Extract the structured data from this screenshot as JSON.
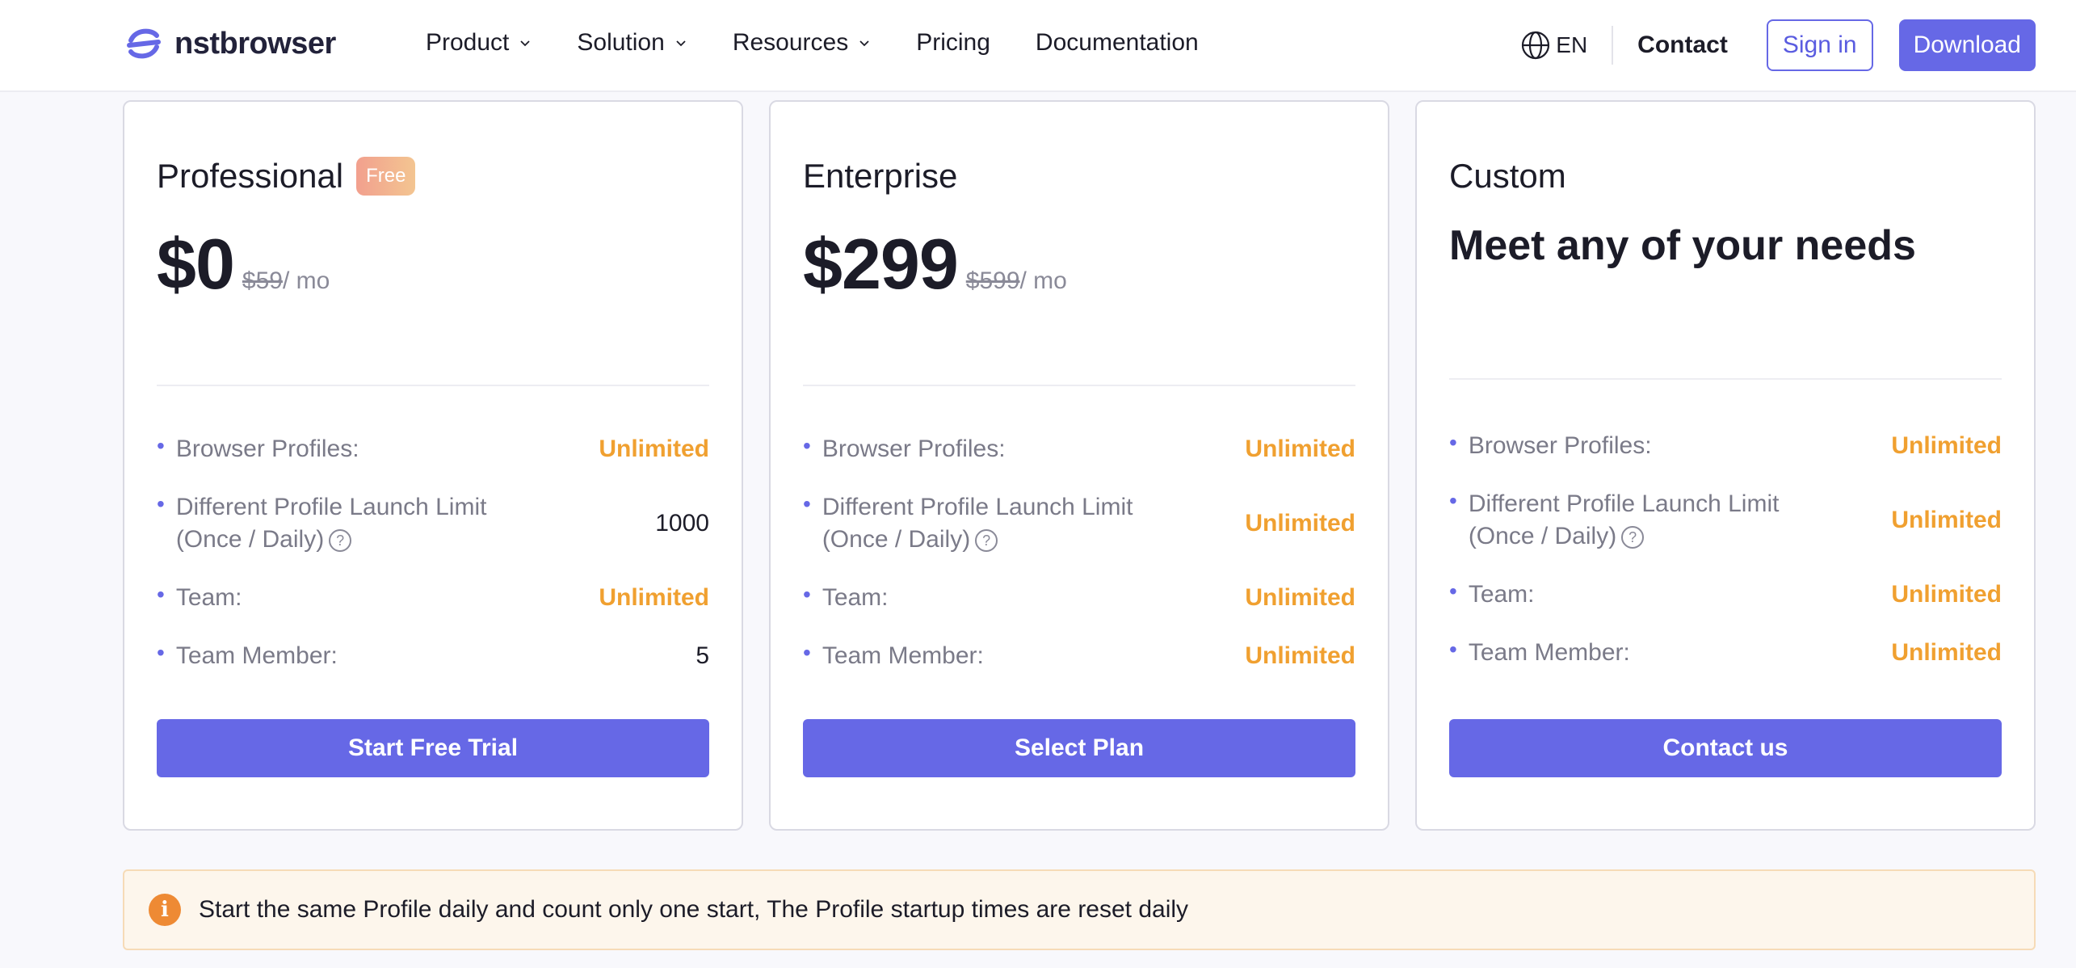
{
  "brand": {
    "name": "nstbrowser"
  },
  "nav": {
    "items": [
      {
        "label": "Product",
        "dropdown": true
      },
      {
        "label": "Solution",
        "dropdown": true
      },
      {
        "label": "Resources",
        "dropdown": true
      },
      {
        "label": "Pricing",
        "dropdown": false
      },
      {
        "label": "Documentation",
        "dropdown": false
      }
    ],
    "language": "EN",
    "contact": "Contact",
    "signin": "Sign in",
    "download": "Download"
  },
  "plans": [
    {
      "name": "Professional",
      "badge": "Free",
      "price": "$0",
      "old_price": "$59",
      "per": "/ mo",
      "features": [
        {
          "label": "Browser Profiles:",
          "value": "Unlimited",
          "highlight": true
        },
        {
          "label": "Different Profile Launch Limit (Once / Daily)",
          "value": "1000",
          "highlight": false,
          "help": true
        },
        {
          "label": "Team:",
          "value": "Unlimited",
          "highlight": true
        },
        {
          "label": "Team Member:",
          "value": "5",
          "highlight": false
        }
      ],
      "cta": "Start Free Trial"
    },
    {
      "name": "Enterprise",
      "price": "$299",
      "old_price": "$599",
      "per": "/ mo",
      "features": [
        {
          "label": "Browser Profiles:",
          "value": "Unlimited",
          "highlight": true
        },
        {
          "label": "Different Profile Launch Limit (Once / Daily)",
          "value": "Unlimited",
          "highlight": true,
          "help": true
        },
        {
          "label": "Team:",
          "value": "Unlimited",
          "highlight": true
        },
        {
          "label": "Team Member:",
          "value": "Unlimited",
          "highlight": true
        }
      ],
      "cta": "Select Plan"
    },
    {
      "name": "Custom",
      "headline": "Meet any of your needs",
      "features": [
        {
          "label": "Browser Profiles:",
          "value": "Unlimited",
          "highlight": true
        },
        {
          "label": "Different Profile Launch Limit (Once / Daily)",
          "value": "Unlimited",
          "highlight": true,
          "help": true
        },
        {
          "label": "Team:",
          "value": "Unlimited",
          "highlight": true
        },
        {
          "label": "Team Member:",
          "value": "Unlimited",
          "highlight": true
        }
      ],
      "cta": "Contact us"
    }
  ],
  "notice": {
    "icon": "info-icon",
    "text": "Start the same Profile daily and count only one start, The Profile startup times are reset daily"
  },
  "colors": {
    "accent": "#6668e6",
    "highlight": "#f0a030",
    "notice_bg": "#fdf6ec",
    "notice_icon": "#ee8a34"
  }
}
